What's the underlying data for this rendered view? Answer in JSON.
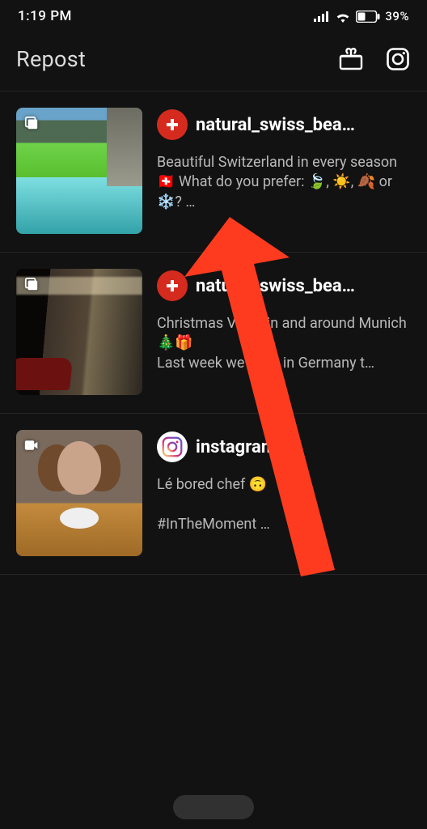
{
  "status": {
    "time": "1:19 PM",
    "battery": "39%"
  },
  "header": {
    "title": "Repost"
  },
  "posts": [
    {
      "id": "p1",
      "username": "natural_swiss_bea…",
      "avatar": "ch",
      "media_badge": "carousel",
      "caption": "Beautiful Switzerland in every season 🇨🇭 What do you prefer: 🍃, ☀️, 🍂 or ❄️? …"
    },
    {
      "id": "p2",
      "username": "natural_swiss_bea…",
      "avatar": "ch",
      "media_badge": "carousel",
      "caption": "Christmas Vibes in and around Munich 🎄🎁\nLast week we were in Germany t…"
    },
    {
      "id": "p3",
      "username": "instagram",
      "avatar": "ig",
      "media_badge": "video",
      "caption": "Lé bored chef 🙃\n\n#InTheMoment …"
    }
  ]
}
